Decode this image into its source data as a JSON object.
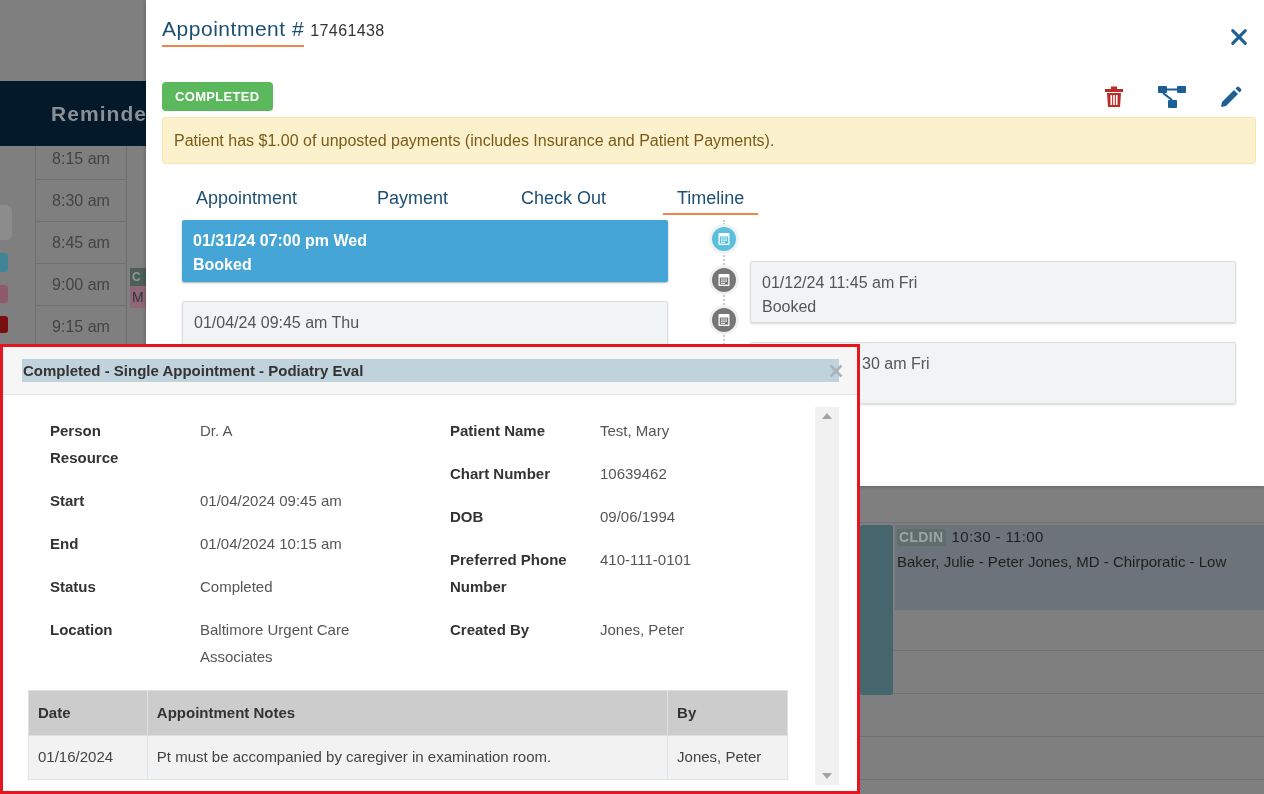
{
  "calendar": {
    "header_title": "Reminde",
    "times": [
      "8:15 am",
      "8:30 am",
      "8:45 am",
      "9:00 am",
      "9:15 am"
    ],
    "side_tabs": [
      {
        "color": "#8c8c8c"
      },
      {
        "color": "#3f8597"
      },
      {
        "color": "#8f5a6c"
      },
      {
        "color": "#7a0f0f"
      }
    ],
    "partial_event": {
      "tag": "C",
      "line": "M"
    },
    "event": {
      "tag": "CLDIN",
      "time": "10:30 - 11:00",
      "description": "Baker, Julie - Peter Jones, MD - Chirporatic - Low"
    }
  },
  "modal": {
    "title": "Appointment #",
    "number": "17461438",
    "status_badge": "COMPLETED",
    "alert": "Patient has $1.00 of unposted payments (includes Insurance and Patient Payments).",
    "tabs": [
      {
        "label": "Appointment",
        "selected": false
      },
      {
        "label": "Payment",
        "selected": false
      },
      {
        "label": "Check Out",
        "selected": false
      },
      {
        "label": "Timeline",
        "selected": true
      }
    ],
    "timeline": [
      {
        "kind": "left",
        "date": "01/31/24 07:00 pm Wed",
        "status": "Booked",
        "selected": true
      },
      {
        "kind": "right",
        "date": "01/12/24 11:45 am Fri",
        "status": "Booked",
        "selected": false
      },
      {
        "kind": "left",
        "date": "01/04/24 09:45 am Thu",
        "selected": false
      },
      {
        "kind": "right",
        "date": "30 am Fri",
        "selected": false,
        "clipped": true
      }
    ]
  },
  "popup": {
    "title": "Completed - Single Appointment - Podiatry Eval",
    "left_fields": [
      {
        "label": "Person Resource",
        "value": "Dr. A"
      },
      {
        "label": "Start",
        "value": "01/04/2024 09:45 am"
      },
      {
        "label": "End",
        "value": "01/04/2024 10:15 am"
      },
      {
        "label": "Status",
        "value": "Completed"
      },
      {
        "label": "Location",
        "value": "Baltimore Urgent Care Associates"
      }
    ],
    "right_fields": [
      {
        "label": "Patient Name",
        "value": "Test, Mary"
      },
      {
        "label": "Chart Number",
        "value": "10639462"
      },
      {
        "label": "DOB",
        "value": "09/06/1994"
      },
      {
        "label": "Preferred Phone Number",
        "value": "410-111-0101"
      },
      {
        "label": "Created By",
        "value": "Jones, Peter"
      }
    ],
    "notes_table": {
      "columns": [
        "Date",
        "Appointment Notes",
        "By"
      ],
      "rows": [
        [
          "01/16/2024",
          "Pt must be accompanied by caregiver in examination room.",
          "Jones, Peter"
        ]
      ]
    }
  }
}
